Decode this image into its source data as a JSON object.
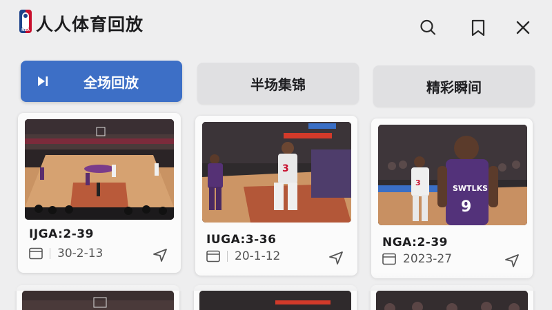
{
  "app": {
    "title": "人人体育回放",
    "logo_text": "NBA"
  },
  "header_icons": [
    "search-icon",
    "bookmark-icon",
    "close-icon"
  ],
  "tabs": [
    {
      "label": "全场回放",
      "active": true
    },
    {
      "label": "半场集锦",
      "active": false
    },
    {
      "label": "精彩瞬间",
      "active": false
    }
  ],
  "cards": [
    {
      "title": "IJGA:2-39",
      "date": "30-2-13",
      "thumbnail": "wide-court-view"
    },
    {
      "title": "IUGA:3-36",
      "date": "20-1-12",
      "thumbnail": "player-jersey-3"
    },
    {
      "title": "NGA:2-39",
      "date": "2023-27",
      "thumbnail": "player-jersey-9"
    }
  ],
  "colors": {
    "accent": "#3d6fc6",
    "background": "#eeeeef",
    "card": "#fbfbfb",
    "tab_inactive": "#e0e0e2"
  }
}
